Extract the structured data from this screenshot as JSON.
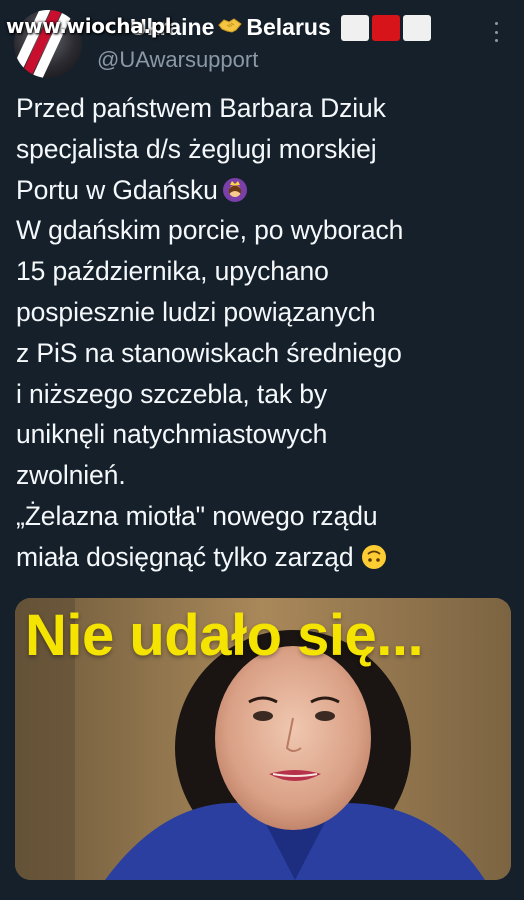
{
  "watermark": "www.wiocha.pl",
  "header": {
    "display_name": "Ukraine",
    "name_suffix": "Belarus",
    "handle": "@UAwarsupport",
    "icons": [
      "handshake-icon",
      "flag-icon",
      "more-options-icon"
    ]
  },
  "tweet": {
    "lines": [
      "Przed państwem Barbara Dziuk",
      "specjalista d/s żeglugi morskiej",
      "Portu w Gdańsku",
      "W gdańskim porcie, po wyborach",
      "15 października, upychano",
      "pospiesznie ludzi powiązanych",
      "z PiS na stanowiskach średniego",
      "i niższego szczebla, tak by",
      "uniknęli natychmiastowych",
      "zwolnień.",
      "„Żelazna miotła\" nowego rządu",
      "miała dosięgnąć tylko zarząd"
    ],
    "emoji": [
      "princess-emoji",
      "upside-down-face-emoji"
    ]
  },
  "media": {
    "caption": "Nie udało się...",
    "caption_color": "#f5e400"
  },
  "colors": {
    "background": "#15202b",
    "text": "#f5f8fa",
    "secondary_text": "#8b98a5"
  }
}
